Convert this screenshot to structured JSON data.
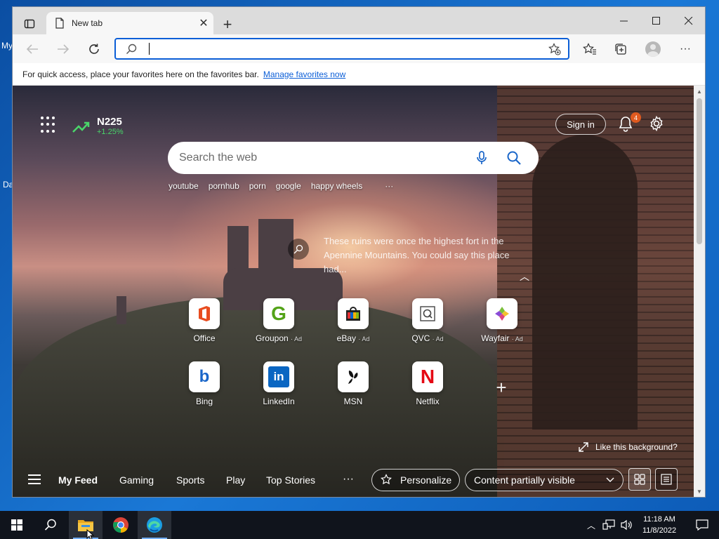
{
  "desktop": {
    "labels": [
      "My",
      "Da"
    ]
  },
  "browser": {
    "tab_title": "New tab",
    "address_placeholder": "",
    "favorites_bar_text": "For quick access, place your favorites here on the favorites bar.",
    "favorites_bar_link": "Manage favorites now"
  },
  "newtab": {
    "ticker_name": "N225",
    "ticker_change": "+1.25%",
    "sign_in": "Sign in",
    "notification_count": "4",
    "search_placeholder": "Search the web",
    "trending": [
      "youtube",
      "pornhub",
      "porn",
      "google",
      "happy wheels"
    ],
    "trending_more": "···",
    "image_info": "These ruins were once the highest fort in the Apennine Mountains. You could say this place had...",
    "tiles": [
      {
        "label": "Office",
        "ad": ""
      },
      {
        "label": "Groupon",
        "ad": "· Ad"
      },
      {
        "label": "eBay",
        "ad": "· Ad"
      },
      {
        "label": "QVC",
        "ad": "· Ad"
      },
      {
        "label": "Wayfair",
        "ad": "· Ad"
      },
      {
        "label": "Bing",
        "ad": ""
      },
      {
        "label": "LinkedIn",
        "ad": ""
      },
      {
        "label": "MSN",
        "ad": ""
      },
      {
        "label": "Netflix",
        "ad": ""
      }
    ],
    "like_background": "Like this background?",
    "feed_tabs": [
      "My Feed",
      "Gaming",
      "Sports",
      "Play",
      "Top Stories"
    ],
    "feed_more": "···",
    "personalize": "Personalize",
    "content_visibility": "Content partially visible"
  },
  "taskbar": {
    "time": "11:18 AM",
    "date": "11/8/2022"
  },
  "colors": {
    "accent": "#0b5ed7",
    "ticker_green": "#4ad66a",
    "badge_orange": "#e05a1f",
    "taskbar": "#10141c"
  }
}
